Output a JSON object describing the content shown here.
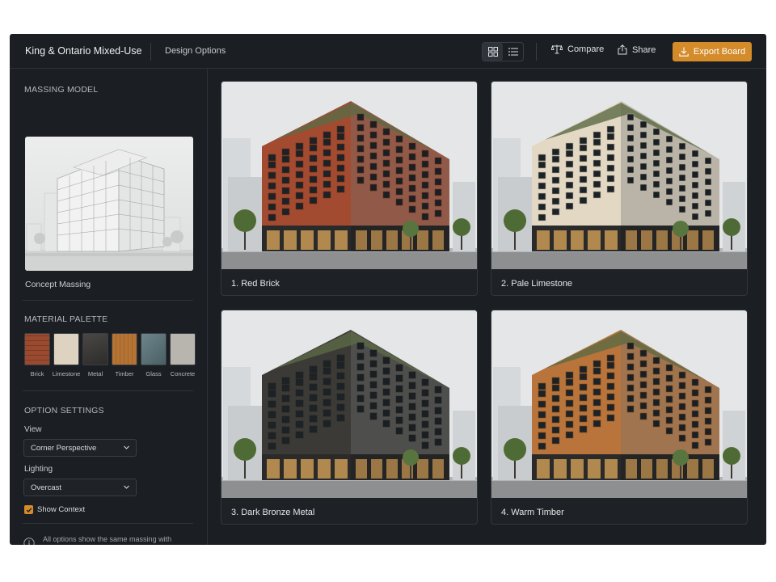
{
  "header": {
    "title": "King & Ontario Mixed-Use",
    "breadcrumb": "Design Options",
    "compare_label": "Compare",
    "share_label": "Share",
    "export_label": "Export Board"
  },
  "sidebar": {
    "massing_title": "MASSING MODEL",
    "massing_caption": "Concept Massing",
    "palette_title": "MATERIAL PALETTE",
    "materials": [
      {
        "label": "Brick",
        "color": "#9a4a2e"
      },
      {
        "label": "Limestone",
        "color": "#ddd3c0"
      },
      {
        "label": "Metal",
        "color": "#3d3b38"
      },
      {
        "label": "Timber",
        "color": "#b57434"
      },
      {
        "label": "Glass",
        "color": "#5b7278"
      },
      {
        "label": "Concrete",
        "color": "#b8b5ae"
      }
    ],
    "settings_title": "OPTION SETTINGS",
    "view_label": "View",
    "view_value": "Corner Perspective",
    "lighting_label": "Lighting",
    "lighting_value": "Overcast",
    "show_context_label": "Show Context",
    "show_context_checked": true,
    "info_text": "All options show the same massing with different material expressions."
  },
  "options": [
    {
      "label": "1. Red Brick",
      "facade": "#a34b30",
      "mullion": "#6e2d1a"
    },
    {
      "label": "2. Pale Limestone",
      "facade": "#e2d8c4",
      "mullion": "#b8ad98"
    },
    {
      "label": "3. Dark Bronze Metal",
      "facade": "#3b3a37",
      "mullion": "#25241f"
    },
    {
      "label": "4. Warm Timber",
      "facade": "#b8743a",
      "mullion": "#7e4c22"
    }
  ],
  "colors": {
    "accent": "#d48b2a",
    "background": "#1b1e22"
  }
}
